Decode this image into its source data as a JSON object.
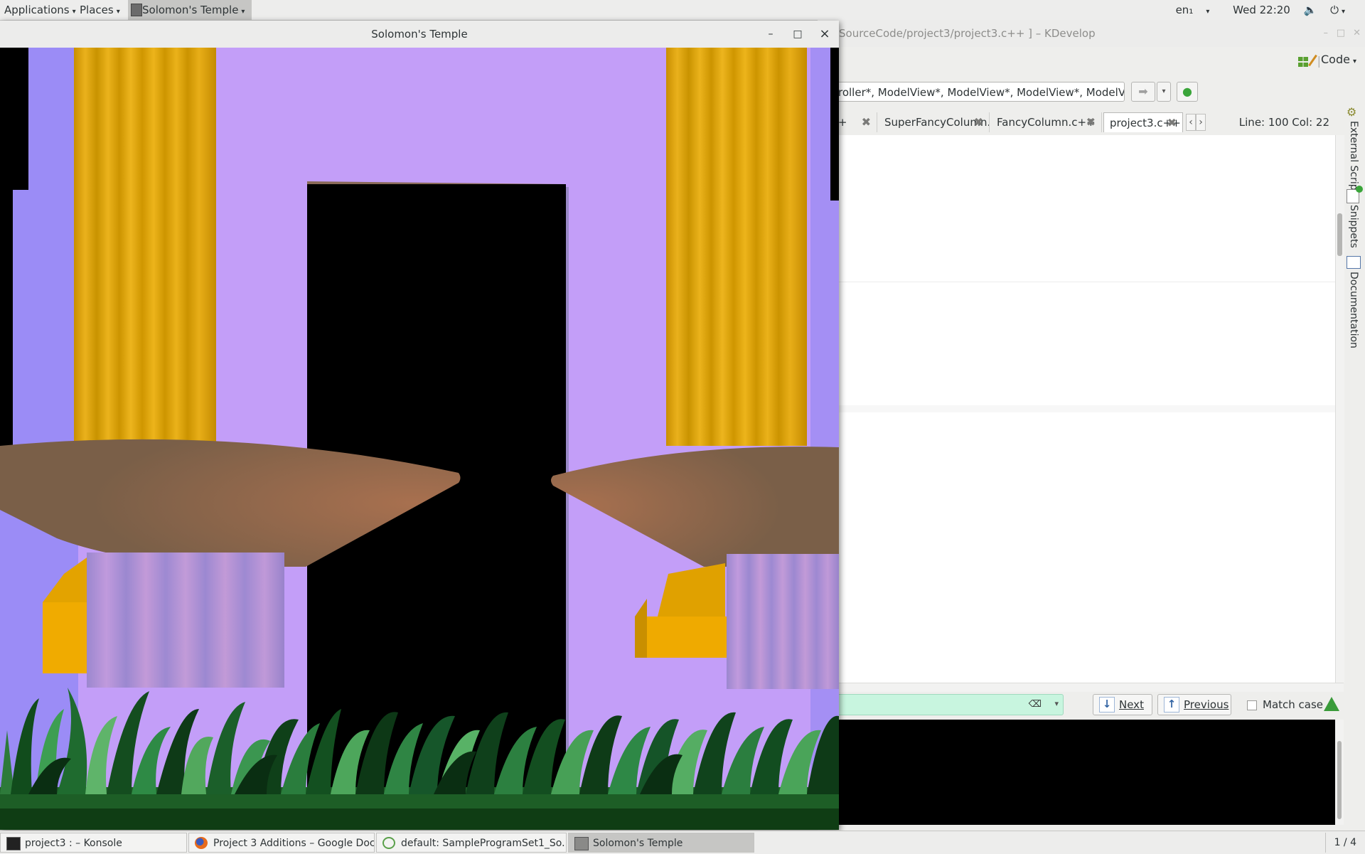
{
  "topbar": {
    "applications": "Applications",
    "places": "Places",
    "active_app": "Solomon's Temple",
    "keyboard": "en₁",
    "clock": "Wed 22:20"
  },
  "glwindow": {
    "title": "Solomon's Temple",
    "minimize": "–",
    "maximize": "□",
    "close": "×"
  },
  "kdevelop": {
    "title": "SourceCode/project3/project3.c++ ] – KDevelop",
    "code_button": "Code",
    "context_text": "roller*, ModelView*, ModelView*, ModelView*, ModelView*)",
    "tabs": [
      {
        "label": "c++"
      },
      {
        "label": "SuperFancyColumn.c++"
      },
      {
        "label": "FancyColumn.c++"
      },
      {
        "label": "project3.c++"
      }
    ],
    "line_col": "Line: 100 Col: 22",
    "side_tools": [
      "External Scripts",
      "Snippets",
      "Documentation"
    ],
    "find": {
      "next": "Next",
      "previous": "Previous",
      "match_case": "Match case"
    }
  },
  "taskbar": {
    "tasks": [
      {
        "label": "project3 : – Konsole"
      },
      {
        "label": "Project 3 Additions – Google Doc..."
      },
      {
        "label": "default:  SampleProgramSet1_So..."
      },
      {
        "label": "Solomon's Temple"
      }
    ],
    "workspace": "1 / 4"
  },
  "colors": {
    "sky": "#c39ef8",
    "column_gold": "#d99f00",
    "capital_brown": "#7d6149",
    "grass": "#1f6b2f",
    "base_lavender": "#a58fd6"
  }
}
